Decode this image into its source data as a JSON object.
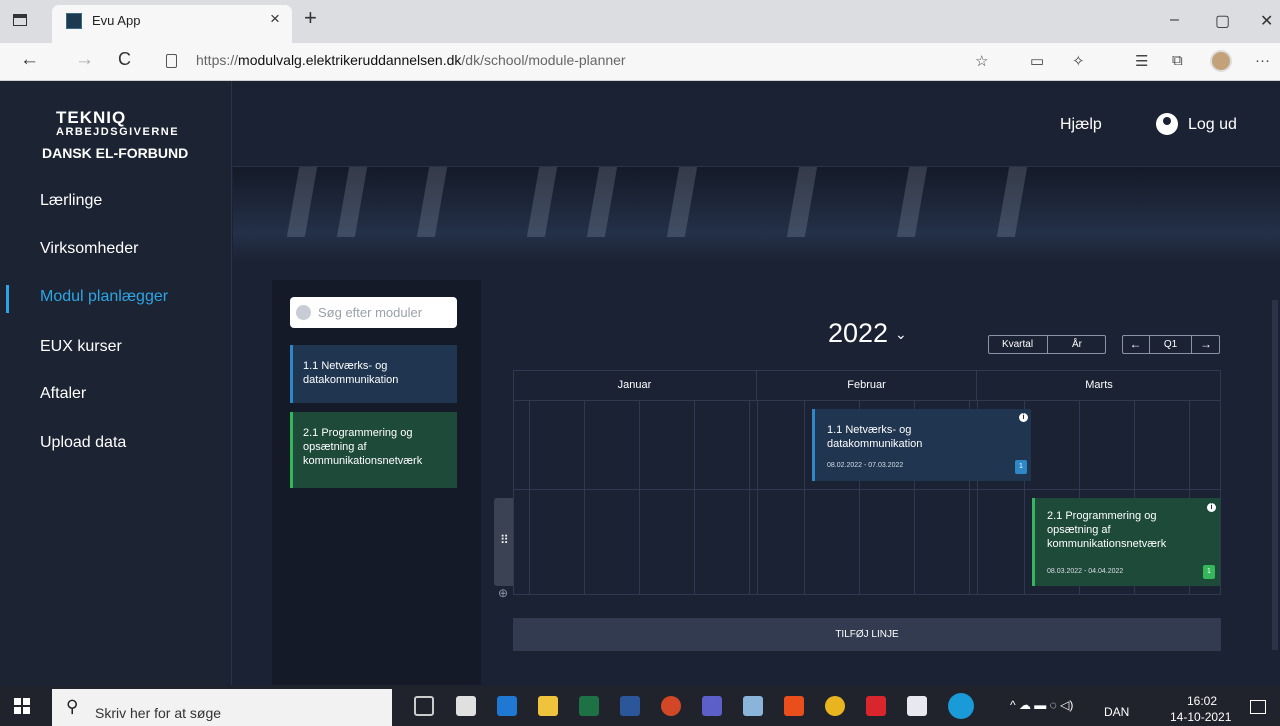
{
  "browser": {
    "tab_title": "Evu App",
    "tab_close": "×",
    "new_tab": "+",
    "window_minimize": "–",
    "window_restore": "▢",
    "window_close": "✕",
    "back": "←",
    "forward": "→",
    "reload": "C",
    "url_prefix": "https://",
    "url_domain": "modulvalg.elektrikeruddannelsen.dk",
    "url_path": "/dk/school/module-planner",
    "more_menu": "···"
  },
  "logo": {
    "line1": "TEKNIQ",
    "line2": "ARBEJDSGIVERNE",
    "line3": "DANSK EL-FORBUND"
  },
  "sidebar": {
    "items": [
      {
        "label": "Lærlinge",
        "active": false
      },
      {
        "label": "Virksomheder",
        "active": false
      },
      {
        "label": "Modul planlægger",
        "active": true
      },
      {
        "label": "EUX kurser",
        "active": false
      },
      {
        "label": "Aftaler",
        "active": false
      },
      {
        "label": "Upload data",
        "active": false
      }
    ]
  },
  "header": {
    "help_label": "Hjælp",
    "logout_label": "Log ud"
  },
  "modules_panel": {
    "search_placeholder": "Søg efter moduler",
    "modules": [
      {
        "title": "1.1 Netværks- og datakommunikation",
        "color": "#2e88c8"
      },
      {
        "title": "2.1 Programmering og opsætning af kommunikationsnetværk",
        "color": "#34b65a"
      }
    ]
  },
  "planner": {
    "year": "2022",
    "year_chevron": "⌄",
    "view_quarter_label": "Kvartal",
    "view_year_label": "År",
    "prev_label": "←",
    "quarter_label": "Q1",
    "next_label": "→",
    "months": [
      "Januar",
      "Februar",
      "Marts"
    ],
    "events": [
      {
        "title": "1.1 Netværks- og datakommunikation",
        "dates": "08.02.2022 - 07.03.2022",
        "badge": "1",
        "info": "i",
        "color": "#2e88c8"
      },
      {
        "title": "2.1 Programmering og opsætning af kommunikationsnetværk",
        "dates": "08.03.2022 - 04.04.2022",
        "badge": "1",
        "info": "i",
        "color": "#34b65a"
      }
    ],
    "drag_handle_glyph": "⠿",
    "add_row_glyph": "⊕",
    "add_line_label": "TILFØJ LINJE"
  },
  "taskbar": {
    "search_placeholder": "Skriv her for at søge",
    "language": "DAN",
    "time": "16:02",
    "date": "14-10-2021"
  }
}
